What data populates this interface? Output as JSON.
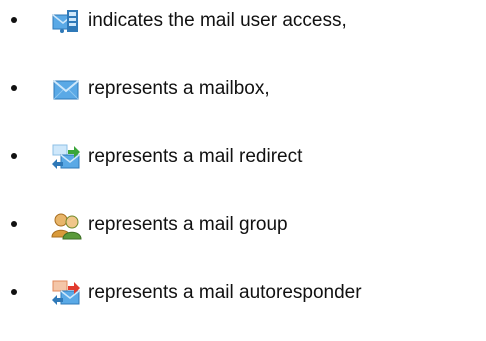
{
  "legend": {
    "items": [
      {
        "icon": "mail-user-access-icon",
        "label": "indicates the mail user access,"
      },
      {
        "icon": "mailbox-icon",
        "label": "represents a mailbox,"
      },
      {
        "icon": "mail-redirect-icon",
        "label": "represents a mail redirect"
      },
      {
        "icon": "mail-group-icon",
        "label": "represents a mail group"
      },
      {
        "icon": "mail-autoresponder-icon",
        "label": "represents a mail autoresponder"
      }
    ]
  },
  "colors": {
    "envelope_blue": "#5aa9e6",
    "envelope_light": "#cfe8fb",
    "arrow_green": "#3aa63a",
    "arrow_red": "#e23b2e",
    "group_person_1": "#d99a3a",
    "group_person_2": "#5a9a3a",
    "text": "#111111"
  }
}
